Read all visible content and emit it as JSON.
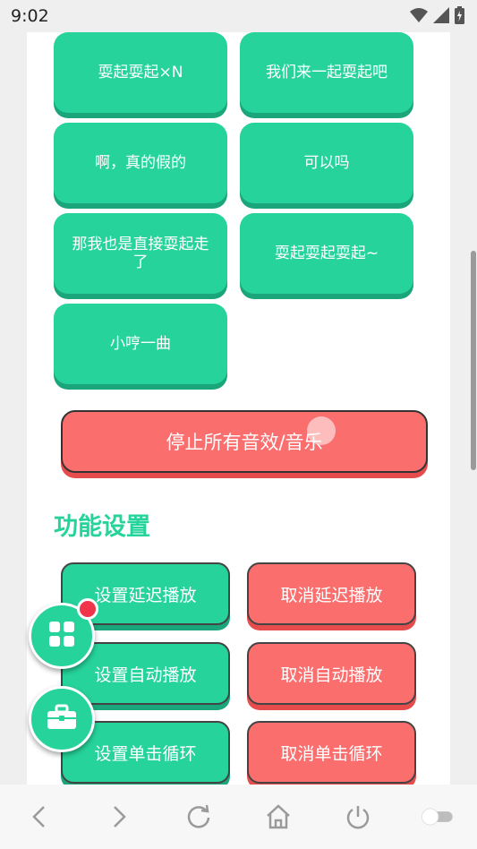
{
  "status": {
    "time": "9:02"
  },
  "sound_buttons": [
    {
      "label": "耍起耍起×N"
    },
    {
      "label": "我们来一起耍起吧"
    },
    {
      "label": "啊，真的假的"
    },
    {
      "label": "可以吗"
    },
    {
      "label": "那我也是直接耍起走了"
    },
    {
      "label": "耍起耍起耍起~"
    },
    {
      "label": "小哼一曲"
    }
  ],
  "stop_button": {
    "label": "停止所有音效/音乐"
  },
  "settings": {
    "title": "功能设置",
    "set_delay": "设置延迟播放",
    "cancel_delay": "取消延迟播放",
    "set_auto": "设置自动播放",
    "cancel_auto": "取消自动播放",
    "set_loop": "设置单击循环",
    "cancel_loop": "取消单击循环"
  },
  "colors": {
    "green": "#26d39a",
    "red": "#fb6e6e",
    "badge": "#f0354a"
  },
  "icons": {
    "fab_top": "grid-icon",
    "fab_bottom": "toolbox-icon",
    "nav": [
      "back-icon",
      "forward-icon",
      "refresh-icon",
      "home-icon",
      "power-icon",
      "toggle-icon"
    ]
  }
}
